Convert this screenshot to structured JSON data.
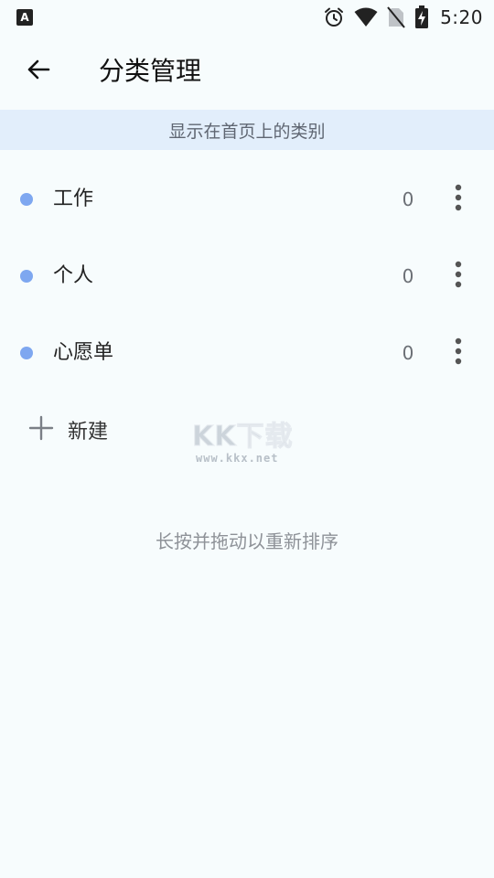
{
  "status_bar": {
    "app_icon": "A",
    "time": "5:20",
    "icons": [
      "alarm-icon",
      "wifi-icon",
      "no-sim-icon",
      "battery-charging-icon"
    ]
  },
  "header": {
    "back_icon": "arrow-left-icon",
    "title": "分类管理"
  },
  "banner": {
    "text": "显示在首页上的类别"
  },
  "categories": [
    {
      "label": "工作",
      "count": "0",
      "dot_color": "#7ea7f0"
    },
    {
      "label": "个人",
      "count": "0",
      "dot_color": "#7ea7f0"
    },
    {
      "label": "心愿单",
      "count": "0",
      "dot_color": "#7ea7f0"
    }
  ],
  "new_button": {
    "icon": "plus-icon",
    "label": "新建"
  },
  "watermark": {
    "logo": "KK下载",
    "url": "www.kkx.net"
  },
  "hint": {
    "text": "长按并拖动以重新排序"
  },
  "colors": {
    "background": "#f7fcfd",
    "banner_bg": "#e2eefb",
    "accent_dot": "#7ea7f0"
  }
}
